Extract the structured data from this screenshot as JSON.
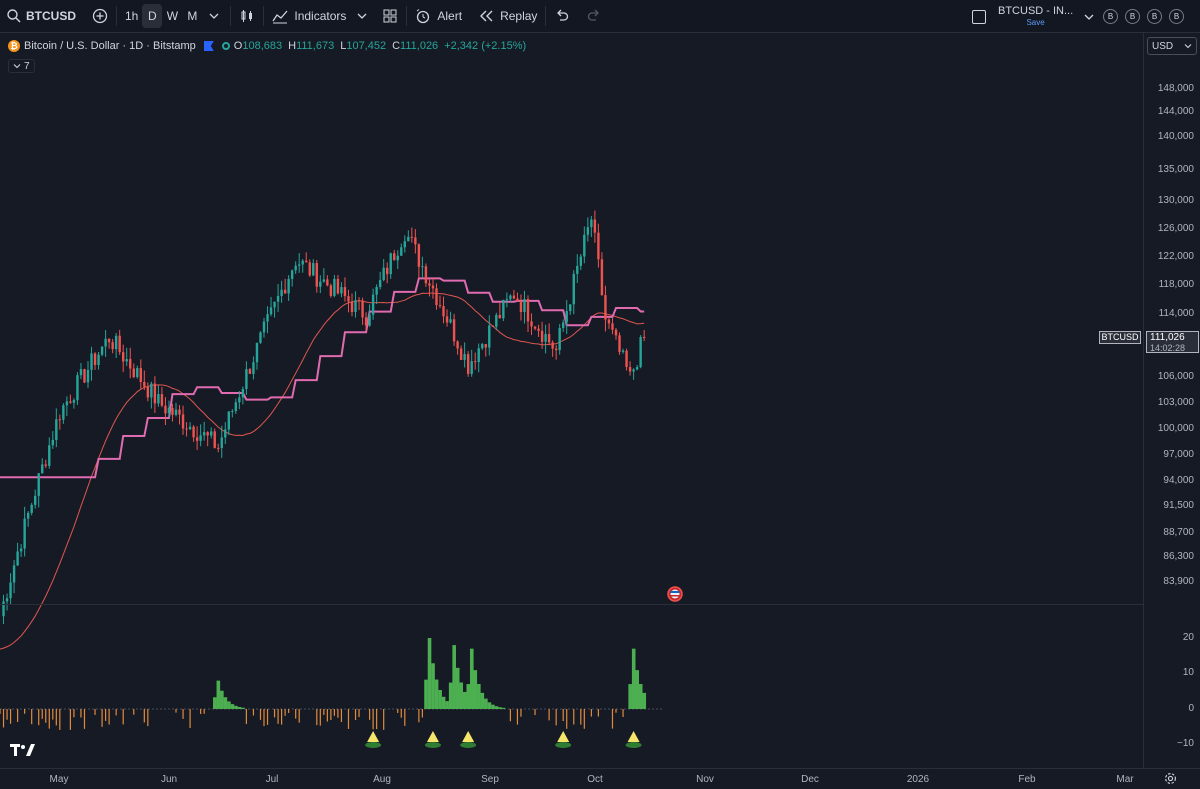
{
  "toolbar": {
    "symbol": "BTCUSD",
    "intervals": [
      "1h",
      "D",
      "W",
      "M"
    ],
    "active_interval": "D",
    "indicators_label": "Indicators",
    "alert_label": "Alert",
    "replay_label": "Replay",
    "layout_name": "BTCUSD - IN...",
    "save_label": "Save",
    "avatar_letters": [
      "B",
      "B",
      "B",
      "B"
    ]
  },
  "legend": {
    "title": "Bitcoin / U.S. Dollar · 1D · Bitstamp",
    "o_label": "O",
    "o_value": "108,683",
    "h_label": "H",
    "h_value": "111,673",
    "l_label": "L",
    "l_value": "107,452",
    "c_label": "C",
    "c_value": "111,026",
    "change": "+2,342 (+2.15%)",
    "collapsed_count": "7"
  },
  "price_scale": {
    "currency": "USD",
    "ticks": [
      "148,000",
      "144,000",
      "140,000",
      "135,000",
      "130,000",
      "126,000",
      "122,000",
      "118,000",
      "114,000",
      "106,000",
      "103,000",
      "100,000",
      "97,000",
      "94,000",
      "91,500",
      "88,700",
      "86,300",
      "83,900"
    ],
    "last_price": "111,026",
    "countdown": "14:02:28",
    "symbol_label": "BTCUSD",
    "osc_ticks": [
      "20",
      "10",
      "0",
      "−10"
    ]
  },
  "time_scale": {
    "ticks": [
      "May",
      "Jun",
      "Jul",
      "Aug",
      "Sep",
      "Oct",
      "Nov",
      "Dec",
      "2026",
      "Feb",
      "Mar"
    ]
  },
  "colors": {
    "up": "#26a69a",
    "down": "#ef5350",
    "ma_pink": "#e06bb0",
    "ma_red": "#e0574f",
    "hist_green": "#4caf50",
    "hist_orange": "#e08a3c",
    "signal_yellow": "#f5e66b",
    "background": "#161a25"
  },
  "chart_data": {
    "type": "candlestick",
    "interval": "1D",
    "x_range": [
      "2025-04-21",
      "2026-03-10"
    ],
    "y_range": [
      82500,
      150500
    ],
    "last_close": 111026,
    "key_points": [
      {
        "date": "2025-04-21",
        "close": 84000
      },
      {
        "date": "2025-05-08",
        "close": 103000
      },
      {
        "date": "2025-05-22",
        "close": 111000
      },
      {
        "date": "2025-06-05",
        "close": 104000
      },
      {
        "date": "2025-06-22",
        "close": 99500
      },
      {
        "date": "2025-07-14",
        "close": 120000
      },
      {
        "date": "2025-08-03",
        "close": 113500
      },
      {
        "date": "2025-08-14",
        "close": 123500
      },
      {
        "date": "2025-09-01",
        "close": 108000
      },
      {
        "date": "2025-09-14",
        "close": 116000
      },
      {
        "date": "2025-09-26",
        "close": 109500
      },
      {
        "date": "2025-10-06",
        "close": 125000
      },
      {
        "date": "2025-10-10",
        "close": 113000
      },
      {
        "date": "2025-10-17",
        "close": 106500
      },
      {
        "date": "2025-10-21",
        "close": 111026
      }
    ],
    "ma_step": {
      "start": 96500,
      "end": 118500
    },
    "ma_slow": {
      "start": 82500,
      "end": 111000
    },
    "oscillator": {
      "range": [
        -14,
        24
      ],
      "peaks": [
        {
          "date": "2025-06-22",
          "value": 8
        },
        {
          "date": "2025-08-21",
          "value": 20
        },
        {
          "date": "2025-08-28",
          "value": 18
        },
        {
          "date": "2025-09-02",
          "value": 17
        },
        {
          "date": "2025-10-18",
          "value": 17
        }
      ],
      "signal_dates": [
        "2025-08-05",
        "2025-08-22",
        "2025-09-01",
        "2025-09-28",
        "2025-10-18"
      ]
    }
  }
}
